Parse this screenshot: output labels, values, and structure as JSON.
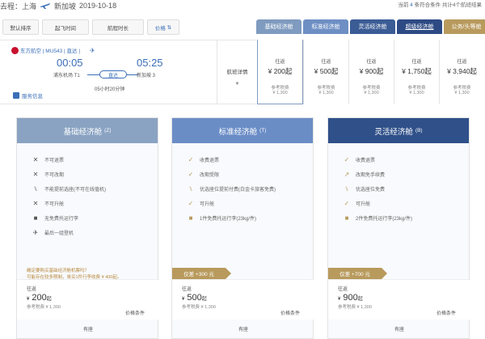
{
  "route": {
    "prefix": "去程：上海",
    "dest": "新加坡",
    "date": "2019-10-18"
  },
  "summary": {
    "pre": "当前",
    "count": "4",
    "mid": "条符合条件 共计4个航班结果"
  },
  "sort": [
    "默认排序",
    "起飞时间",
    "航程时长",
    "价格"
  ],
  "tabs": [
    "基础经济舱",
    "标准经济舱",
    "灵活经济舱",
    "超级经济舱",
    "公务/头等舱"
  ],
  "flight": {
    "airline": "东方航空 | MU543 | 直达 |",
    "dep_time": "00:05",
    "arr_time": "05:25",
    "dep_airport": "浦东机场 T1",
    "arr_airport": "新加坡 3",
    "direct": "直达",
    "duration": "05小时20分钟",
    "service": "服务信息",
    "detail": "航班详情"
  },
  "prices": [
    {
      "label": "往返",
      "price": "¥ 200起",
      "ref": "参考税费",
      "tax": "¥ 1,300"
    },
    {
      "label": "往返",
      "price": "¥ 500起",
      "ref": "参考税费",
      "tax": "¥ 1,300"
    },
    {
      "label": "往返",
      "price": "¥ 900起",
      "ref": "参考税费",
      "tax": "¥ 1,300"
    },
    {
      "label": "往返",
      "price": "¥ 1,750起",
      "ref": "参考税费",
      "tax": "¥ 1,300"
    },
    {
      "label": "往返",
      "price": "¥ 3,940起",
      "ref": "参考税费",
      "tax": "¥ 1,300"
    }
  ],
  "cards": [
    {
      "title": "基础经济舱",
      "sub": "(Z)",
      "features": [
        "不可退票",
        "不可改期",
        "不能提前选座(不可在线值机)",
        "不可升舱",
        "无免费托运行李",
        "最后一组登机"
      ],
      "note1": "确定要购买基础经济舱机票吗？",
      "note2": "可能存在较多限制，单买1件行李收费 ¥ 400起。",
      "price_label": "往返",
      "price_num": "200",
      "price_unit": "起",
      "price_cur": "¥",
      "ref": "参考税费 ¥ 1,300",
      "cond": "价格条件",
      "foot": "有座"
    },
    {
      "title": "标准经济舱",
      "sub": "(T)",
      "features": [
        "收费退票",
        "改期受限",
        "优选座位提前付费(白金卡旅客免费)",
        "可升舱",
        "1件免费托运行李(23kg/件)"
      ],
      "upgrade": "仅差 +300 元",
      "price_label": "往返",
      "price_num": "500",
      "price_unit": "起",
      "price_cur": "¥",
      "ref": "参考税费 ¥ 1,300",
      "cond": "价格条件",
      "foot": "有座"
    },
    {
      "title": "灵活经济舱",
      "sub": "(B)",
      "features": [
        "收费退票",
        "改期免手续费",
        "优选座位免费",
        "可升舱",
        "2件免费托运行李(23kg/件)"
      ],
      "upgrade": "仅差 +700 元",
      "price_label": "往返",
      "price_num": "900",
      "price_unit": "起",
      "price_cur": "¥",
      "ref": "参考税费 ¥ 1,300",
      "cond": "价格条件",
      "foot": "有座"
    }
  ],
  "colors": {
    "accent": "#3a6fb8",
    "gold": "#b89a5d",
    "basic": "#8aa3c2",
    "standard": "#6b8dc6",
    "flex": "#2f5089"
  }
}
